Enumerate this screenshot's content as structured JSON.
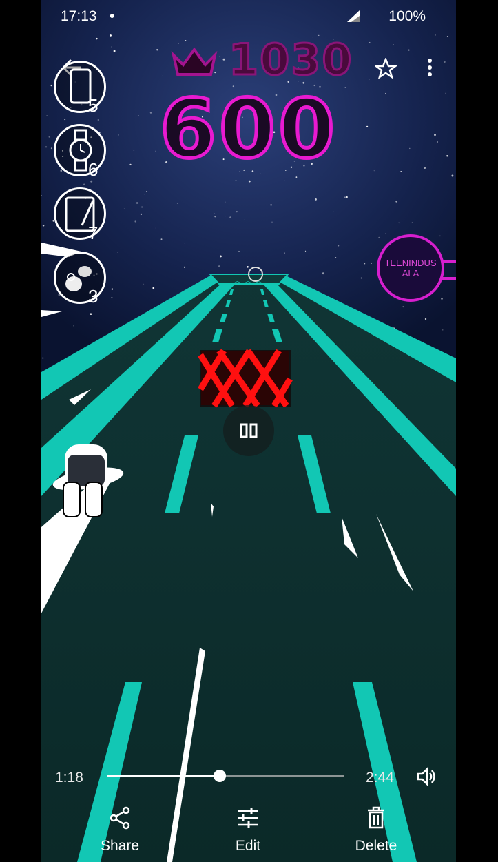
{
  "status_bar": {
    "time": "17:13",
    "dot": "•",
    "battery": "100%"
  },
  "game": {
    "best_score": "1030",
    "score": "600",
    "powerups": [
      {
        "icon": "phone-icon",
        "count": "5"
      },
      {
        "icon": "watch-icon",
        "count": "6"
      },
      {
        "icon": "tablet-icon",
        "count": "7"
      },
      {
        "icon": "earbuds-icon",
        "count": "3"
      }
    ],
    "booth_label_line1": "TEENINDUS",
    "booth_label_line2": "ALA",
    "colors": {
      "neon_pink": "#e81ad0",
      "road_teal": "#12c7b4",
      "road_dark": "#0a2b2a"
    }
  },
  "video": {
    "current_time": "1:18",
    "total_time": "2:44",
    "progress": 0.475
  },
  "actions": {
    "share": "Share",
    "edit": "Edit",
    "delete": "Delete"
  }
}
